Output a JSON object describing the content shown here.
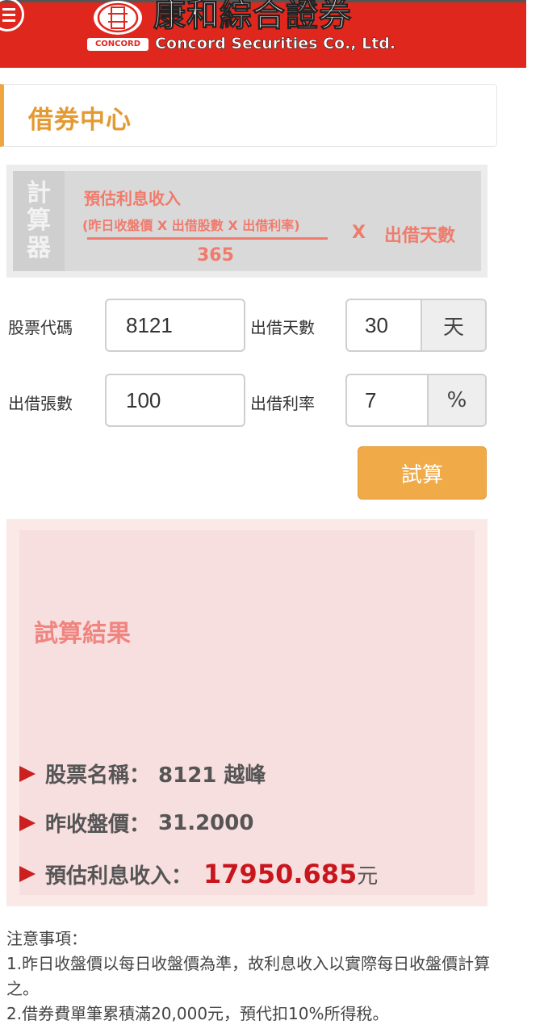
{
  "header": {
    "logo_cn": "康和綜合證券",
    "logo_en": "Concord Securities Co., Ltd.",
    "logo_small": "CONCORD",
    "brand_color": "#e0271e"
  },
  "page": {
    "title": "借券中心"
  },
  "formula": {
    "side": [
      "計",
      "算",
      "器"
    ],
    "label": "預估利息收入",
    "numerator": "(昨日收盤價 X 出借股數 X 出借利率)",
    "denominator": "365",
    "times": "X",
    "days": "出借天數"
  },
  "form": {
    "stock_code_label": "股票代碼",
    "stock_code_value": "8121",
    "lend_days_label": "出借天數",
    "lend_days_value": "30",
    "lend_days_unit": "天",
    "lend_sheets_label": "出借張數",
    "lend_sheets_value": "100",
    "lend_rate_label": "出借利率",
    "lend_rate_value": "7",
    "lend_rate_unit": "%",
    "calc_button": "試算"
  },
  "result": {
    "title": "試算結果",
    "stock_name_label": "股票名稱：",
    "stock_name_value": "8121 越峰",
    "prev_close_label": "昨收盤價：",
    "prev_close_value": "31.2000",
    "income_label": "預估利息收入：",
    "income_value": "17950.685",
    "income_unit": "元"
  },
  "notes": {
    "title": "注意事項：",
    "items": [
      "1.昨日收盤價以每日收盤價為準，故利息收入以實際每日收盤價計算之。",
      "2.借券費單筆累積滿20,000元，預代扣10%所得稅。"
    ]
  }
}
